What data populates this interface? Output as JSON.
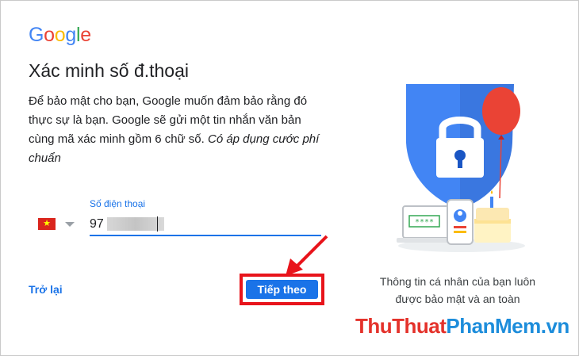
{
  "logo": {
    "letters": [
      "G",
      "o",
      "o",
      "g",
      "l",
      "e"
    ],
    "colors": [
      "#4285f4",
      "#ea4335",
      "#fbbc05",
      "#4285f4",
      "#34a853",
      "#ea4335"
    ]
  },
  "page": {
    "title": "Xác minh số đ.thoại",
    "description": "Để bảo mật cho bạn, Google muốn đảm bảo rằng đó thực sự là bạn. Google sẽ gửi một tin nhắn văn bản cùng mã xác minh gồm 6 chữ số.",
    "description_italic": "Có áp dụng cước phí chuẩn"
  },
  "phone": {
    "label": "Số điện thoại",
    "value": "97",
    "country_flag": "vietnam-flag-icon"
  },
  "actions": {
    "back_label": "Trở lại",
    "next_label": "Tiếp theo"
  },
  "illustration": {
    "caption_line1": "Thông tin cá nhân của bạn luôn",
    "caption_line2": "được bảo mật và an toàn",
    "screen_text": "****"
  },
  "watermark": {
    "part1": "ThuThuat",
    "part2": "PhanMem",
    "part3": ".vn"
  },
  "colors": {
    "accent": "#1a73e8",
    "highlight": "#e8141b",
    "shield": "#4285f4",
    "balloon": "#ea4335"
  }
}
